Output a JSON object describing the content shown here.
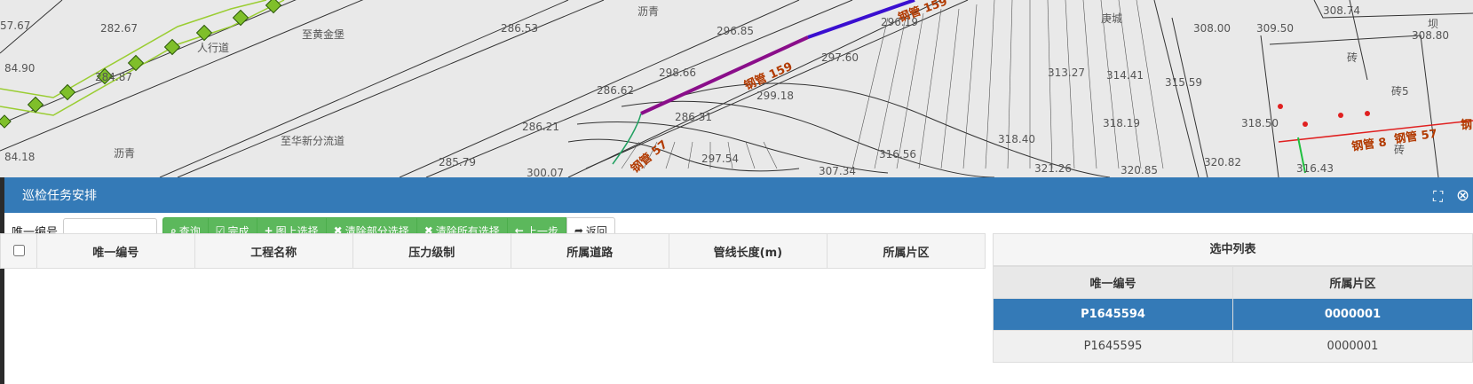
{
  "map": {
    "labels": [
      "57.67",
      "282.67",
      "人行道",
      "至黄金堡",
      "286.53",
      "沥青",
      "296.85",
      "296.19",
      "庚城",
      "308.00",
      "309.50",
      "308.74",
      "坝",
      "308.80",
      "84.90",
      "284.87",
      "298.66",
      "297.60",
      "313.27",
      "314.41",
      "315.59",
      "砖",
      "砖5",
      "286.62",
      "299.18",
      "286.31",
      "318.19",
      "318.50",
      "286.21",
      "至华新分流道",
      "318.40",
      "84.18",
      "沥青",
      "316.56",
      "321.26",
      "320.85",
      "320.82",
      "316.43",
      "285.79",
      "300.07",
      "297.54",
      "307.34",
      "砖"
    ],
    "pipe_labels": [
      "钢管 159",
      "钢管 159",
      "钢管 57",
      "钢管 8",
      "钢管 57",
      "钢"
    ]
  },
  "panel": {
    "title": "巡检任务安排",
    "expand_icon": "expand-icon",
    "close_icon": "close-circle-icon"
  },
  "toolbar": {
    "id_label": "唯一编号",
    "id_value": "",
    "buttons": [
      {
        "icon": "search-icon",
        "glyph": "⌕",
        "label": "查询"
      },
      {
        "icon": "check-square-icon",
        "glyph": "☑",
        "label": "完成"
      },
      {
        "icon": "plus-icon",
        "glyph": "+",
        "label": "图上选择"
      },
      {
        "icon": "x-icon",
        "glyph": "✖",
        "label": "清除部分选择"
      },
      {
        "icon": "x-icon",
        "glyph": "✖",
        "label": "清除所有选择"
      },
      {
        "icon": "arrow-left-icon",
        "glyph": "←",
        "label": "上一步"
      },
      {
        "icon": "share-icon",
        "glyph": "➦",
        "label": "返回"
      }
    ]
  },
  "main_table": {
    "columns": [
      "唯一编号",
      "工程名称",
      "压力级制",
      "所属道路",
      "管线长度(m)",
      "所属片区"
    ]
  },
  "selected_list": {
    "title": "选中列表",
    "columns": [
      "唯一编号",
      "所属片区"
    ],
    "rows": [
      {
        "id": "P1645594",
        "area": "0000001",
        "selected": true
      },
      {
        "id": "P1645595",
        "area": "0000001",
        "selected": false
      }
    ]
  }
}
